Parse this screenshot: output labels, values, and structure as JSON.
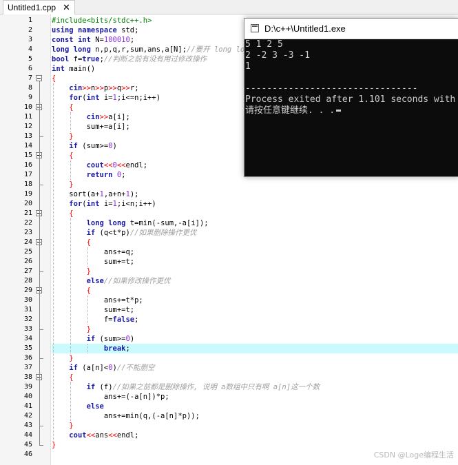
{
  "tab": {
    "title": "Untitled1.cpp",
    "close_label": "✕"
  },
  "editor": {
    "highlight_line": 35,
    "lines": [
      {
        "n": "1",
        "tokens": [
          [
            "pp",
            "#include<bits/stdc++.h>"
          ]
        ]
      },
      {
        "n": "2",
        "tokens": [
          [
            "kw",
            "using"
          ],
          [
            "id",
            " "
          ],
          [
            "kw",
            "namespace"
          ],
          [
            "id",
            " std;"
          ]
        ]
      },
      {
        "n": "3",
        "tokens": [
          [
            "kw",
            "const"
          ],
          [
            "id",
            " "
          ],
          [
            "kw",
            "int"
          ],
          [
            "id",
            " N="
          ],
          [
            "num",
            "100010"
          ],
          [
            "id",
            ";"
          ]
        ]
      },
      {
        "n": "4",
        "tokens": [
          [
            "kw",
            "long"
          ],
          [
            "id",
            " "
          ],
          [
            "kw",
            "long"
          ],
          [
            "id",
            " n,p,q,r,sum,ans,a[N];"
          ],
          [
            "cm",
            "//要开 long long"
          ]
        ]
      },
      {
        "n": "5",
        "tokens": [
          [
            "kw",
            "bool"
          ],
          [
            "id",
            " f="
          ],
          [
            "kw",
            "true"
          ],
          [
            "id",
            ";"
          ],
          [
            "cm",
            "//判断之前有没有用过修改操作"
          ]
        ]
      },
      {
        "n": "6",
        "tokens": [
          [
            "kw",
            "int"
          ],
          [
            "id",
            " main()"
          ]
        ]
      },
      {
        "n": "7",
        "tokens": [
          [
            "op",
            "{"
          ]
        ]
      },
      {
        "n": "8",
        "tokens": [
          [
            "id",
            "    "
          ],
          [
            "kw",
            "cin"
          ],
          [
            "op",
            ">>"
          ],
          [
            "id",
            "n"
          ],
          [
            "op",
            ">>"
          ],
          [
            "id",
            "p"
          ],
          [
            "op",
            ">>"
          ],
          [
            "id",
            "q"
          ],
          [
            "op",
            ">>"
          ],
          [
            "id",
            "r;"
          ]
        ]
      },
      {
        "n": "9",
        "tokens": [
          [
            "id",
            "    "
          ],
          [
            "kw",
            "for"
          ],
          [
            "id",
            "("
          ],
          [
            "kw",
            "int"
          ],
          [
            "id",
            " i="
          ],
          [
            "num",
            "1"
          ],
          [
            "id",
            ";i<=n;i++)"
          ]
        ]
      },
      {
        "n": "10",
        "tokens": [
          [
            "id",
            "    "
          ],
          [
            "op",
            "{"
          ]
        ]
      },
      {
        "n": "11",
        "tokens": [
          [
            "id",
            "        "
          ],
          [
            "kw",
            "cin"
          ],
          [
            "op",
            ">>"
          ],
          [
            "id",
            "a[i];"
          ]
        ]
      },
      {
        "n": "12",
        "tokens": [
          [
            "id",
            "        sum+=a[i];"
          ]
        ]
      },
      {
        "n": "13",
        "tokens": [
          [
            "id",
            "    "
          ],
          [
            "op",
            "}"
          ]
        ]
      },
      {
        "n": "14",
        "tokens": [
          [
            "id",
            "    "
          ],
          [
            "kw",
            "if"
          ],
          [
            "id",
            " (sum>="
          ],
          [
            "num",
            "0"
          ],
          [
            "id",
            ")"
          ]
        ]
      },
      {
        "n": "15",
        "tokens": [
          [
            "id",
            "    "
          ],
          [
            "op",
            "{"
          ]
        ]
      },
      {
        "n": "16",
        "tokens": [
          [
            "id",
            "        "
          ],
          [
            "kw",
            "cout"
          ],
          [
            "op",
            "<<"
          ],
          [
            "num",
            "0"
          ],
          [
            "op",
            "<<"
          ],
          [
            "id",
            "endl;"
          ]
        ]
      },
      {
        "n": "17",
        "tokens": [
          [
            "id",
            "        "
          ],
          [
            "kw",
            "return"
          ],
          [
            "id",
            " "
          ],
          [
            "num",
            "0"
          ],
          [
            "id",
            ";"
          ]
        ]
      },
      {
        "n": "18",
        "tokens": [
          [
            "id",
            "    "
          ],
          [
            "op",
            "}"
          ]
        ]
      },
      {
        "n": "19",
        "tokens": [
          [
            "id",
            "    sort(a+"
          ],
          [
            "num",
            "1"
          ],
          [
            "id",
            ",a+n+"
          ],
          [
            "num",
            "1"
          ],
          [
            "id",
            ");"
          ]
        ]
      },
      {
        "n": "20",
        "tokens": [
          [
            "id",
            "    "
          ],
          [
            "kw",
            "for"
          ],
          [
            "id",
            "("
          ],
          [
            "kw",
            "int"
          ],
          [
            "id",
            " i="
          ],
          [
            "num",
            "1"
          ],
          [
            "id",
            ";i<n;i++)"
          ]
        ]
      },
      {
        "n": "21",
        "tokens": [
          [
            "id",
            "    "
          ],
          [
            "op",
            "{"
          ]
        ]
      },
      {
        "n": "22",
        "tokens": [
          [
            "id",
            "        "
          ],
          [
            "kw",
            "long"
          ],
          [
            "id",
            " "
          ],
          [
            "kw",
            "long"
          ],
          [
            "id",
            " t=min(-sum,-a[i]);"
          ]
        ]
      },
      {
        "n": "23",
        "tokens": [
          [
            "id",
            "        "
          ],
          [
            "kw",
            "if"
          ],
          [
            "id",
            " (q<t*p)"
          ],
          [
            "cm",
            "//如果删除操作更优"
          ]
        ]
      },
      {
        "n": "24",
        "tokens": [
          [
            "id",
            "        "
          ],
          [
            "op",
            "{"
          ]
        ]
      },
      {
        "n": "25",
        "tokens": [
          [
            "id",
            "            ans+=q;"
          ]
        ]
      },
      {
        "n": "26",
        "tokens": [
          [
            "id",
            "            sum+=t;"
          ]
        ]
      },
      {
        "n": "27",
        "tokens": [
          [
            "id",
            "        "
          ],
          [
            "op",
            "}"
          ]
        ]
      },
      {
        "n": "28",
        "tokens": [
          [
            "id",
            "        "
          ],
          [
            "kw",
            "else"
          ],
          [
            "cm",
            "//如果修改操作更优"
          ]
        ]
      },
      {
        "n": "29",
        "tokens": [
          [
            "id",
            "        "
          ],
          [
            "op",
            "{"
          ]
        ]
      },
      {
        "n": "30",
        "tokens": [
          [
            "id",
            "            ans+=t*p;"
          ]
        ]
      },
      {
        "n": "31",
        "tokens": [
          [
            "id",
            "            sum+=t;"
          ]
        ]
      },
      {
        "n": "32",
        "tokens": [
          [
            "id",
            "            f="
          ],
          [
            "kw",
            "false"
          ],
          [
            "id",
            ";"
          ]
        ]
      },
      {
        "n": "33",
        "tokens": [
          [
            "id",
            "        "
          ],
          [
            "op",
            "}"
          ]
        ]
      },
      {
        "n": "34",
        "tokens": [
          [
            "id",
            "        "
          ],
          [
            "kw",
            "if"
          ],
          [
            "id",
            " (sum>="
          ],
          [
            "num",
            "0"
          ],
          [
            "id",
            ")"
          ]
        ]
      },
      {
        "n": "35",
        "tokens": [
          [
            "id",
            "            "
          ],
          [
            "kw",
            "break"
          ],
          [
            "id",
            ";"
          ]
        ]
      },
      {
        "n": "36",
        "tokens": [
          [
            "id",
            "    "
          ],
          [
            "op",
            "}"
          ]
        ]
      },
      {
        "n": "37",
        "tokens": [
          [
            "id",
            "    "
          ],
          [
            "kw",
            "if"
          ],
          [
            "id",
            " (a[n]<"
          ],
          [
            "num",
            "0"
          ],
          [
            "id",
            ")"
          ],
          [
            "cm",
            "//不能删空"
          ]
        ]
      },
      {
        "n": "38",
        "tokens": [
          [
            "id",
            "    "
          ],
          [
            "op",
            "{"
          ]
        ]
      },
      {
        "n": "39",
        "tokens": [
          [
            "id",
            "        "
          ],
          [
            "kw",
            "if"
          ],
          [
            "id",
            " (f)"
          ],
          [
            "cm",
            "//如果之前都是删除操作, 说明 a数组中只有啊 a[n]这一个数"
          ]
        ]
      },
      {
        "n": "40",
        "tokens": [
          [
            "id",
            "            ans+=(-a[n])*p;"
          ]
        ]
      },
      {
        "n": "41",
        "tokens": [
          [
            "id",
            "        "
          ],
          [
            "kw",
            "else"
          ]
        ]
      },
      {
        "n": "42",
        "tokens": [
          [
            "id",
            "            ans+=min(q,(-a[n]*p));"
          ]
        ]
      },
      {
        "n": "43",
        "tokens": [
          [
            "id",
            "    "
          ],
          [
            "op",
            "}"
          ]
        ]
      },
      {
        "n": "44",
        "tokens": [
          [
            "id",
            "    "
          ],
          [
            "kw",
            "cout"
          ],
          [
            "op",
            "<<"
          ],
          [
            "id",
            "ans"
          ],
          [
            "op",
            "<<"
          ],
          [
            "id",
            "endl;"
          ]
        ]
      },
      {
        "n": "45",
        "tokens": [
          [
            "op",
            "}"
          ]
        ]
      },
      {
        "n": "46",
        "tokens": []
      }
    ],
    "fold_lines": [
      7,
      10,
      15,
      21,
      24,
      29,
      38
    ]
  },
  "console": {
    "title": "D:\\c++\\Untitled1.exe",
    "lines": [
      "5 1 2 5",
      "2 -2 3 -3 -1",
      "1",
      "",
      "--------------------------------",
      "Process exited after 1.101 seconds with",
      "请按任意键继续. . ."
    ]
  },
  "watermark": "CSDN @Loge编程生活"
}
